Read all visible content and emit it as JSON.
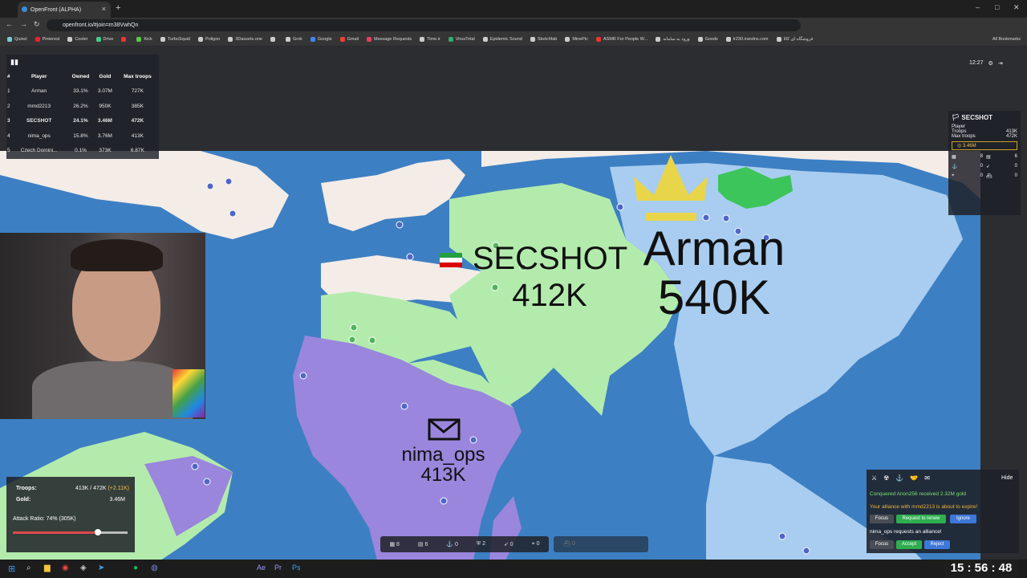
{
  "browser": {
    "tab_title": "OpenFront (ALPHA)",
    "url": "openfront.io/#join=m38VwhQn",
    "bookmarks": [
      "Quixel",
      "Pinterest",
      "Cooler",
      "Drive",
      "",
      "Kick",
      "TurboSquid",
      "Poligon",
      "3Dassets.one",
      "",
      "Grok",
      "Google",
      "Gmail",
      "Message Requests",
      "Time.ir",
      "VirusTotal",
      "Epidemic Sound",
      "Sketchfab",
      "MinePic",
      "ASMR For People W...",
      "ورود به سامانه",
      "Goods",
      "lr230.irandns.com",
      "فروشگاه ای کالا"
    ],
    "all_bookmarks": "All Bookmarks"
  },
  "leaderboard": {
    "headers": [
      "#",
      "Player",
      "Owned",
      "Gold",
      "Max troops"
    ],
    "rows": [
      {
        "rank": "1",
        "player": "Arman",
        "owned": "33.1%",
        "gold": "3.07M",
        "max": "727K",
        "bold": false
      },
      {
        "rank": "2",
        "player": "mmd2213",
        "owned": "26.2%",
        "gold": "950K",
        "max": "385K",
        "bold": false
      },
      {
        "rank": "3",
        "player": "SECSHOT",
        "owned": "24.1%",
        "gold": "3.46M",
        "max": "472K",
        "bold": true
      },
      {
        "rank": "4",
        "player": "nima_ops",
        "owned": "15.8%",
        "gold": "3.76M",
        "max": "413K",
        "bold": false
      },
      {
        "rank": "5",
        "player": "Czech Domini...",
        "owned": "0.1%",
        "gold": "373K",
        "max": "6.87K",
        "bold": false
      }
    ]
  },
  "timer": "12:27",
  "player_panel": {
    "name": "SECSHOT",
    "type": "Player",
    "troops_label": "Troops",
    "troops": "413K",
    "max_label": "Max troops",
    "max": "472K",
    "gold": "3.46M",
    "counts": [
      "8",
      "6",
      "0",
      "0",
      "0",
      "0"
    ]
  },
  "map_labels": {
    "secshot_name": "SECSHOT",
    "secshot_troops": "412K",
    "arman_name": "Arman",
    "arman_troops": "540K",
    "nima_name": "nima_ops",
    "nima_troops": "413K"
  },
  "stats": {
    "troops_label": "Troops:",
    "troops_value": "413K / 472K",
    "troops_delta": "(+2.11K)",
    "gold_label": "Gold:",
    "gold_value": "3.46M",
    "attack_label": "Attack Ratio: 74% (305K)",
    "attack_ratio": 0.74
  },
  "events": {
    "hide": "Hide",
    "msg1": "Conquered Anon256 received 2.32M gold",
    "msg2": "Your alliance with mmd2213 is about to expire!",
    "focus": "Focus",
    "renew": "Request to renew",
    "ignore": "Ignore",
    "msg3": "nima_ops requests an alliance!",
    "accept": "Accept",
    "reject": "Reject"
  },
  "bottom_bar": [
    "8",
    "6",
    "0",
    "2",
    "0",
    "0"
  ],
  "bottom_bar2": [
    "0"
  ],
  "clock": "15 : 56 : 48",
  "colors": {
    "ocean": "#3d7fc3",
    "secshot": "#b3ebad",
    "arman": "#a8cdf0",
    "nima": "#9a86dc",
    "neutral": "#f3ece7"
  }
}
